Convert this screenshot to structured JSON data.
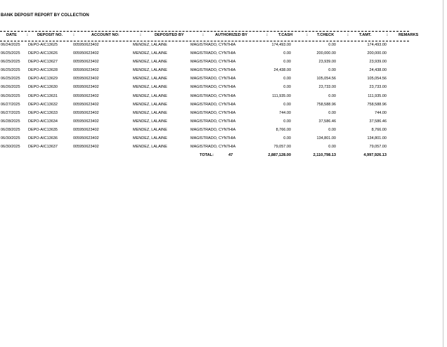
{
  "report": {
    "title": "BANK DEPOSIT REPORT BY COLLECTION"
  },
  "columns": {
    "date": "DATE",
    "sep1": ":",
    "deposit_no": "DEPOSIT NO.",
    "sep2": ":",
    "account_no": "ACCOUNT NO:",
    "sep3": ":",
    "deposited_by": "DEPOSITED BY",
    "sep4": ":",
    "authorized_by": "AUTHORIZED BY",
    "sep5": ":",
    "t_cash": "T.CASH",
    "sep6": ":",
    "t_check": "T.CHECK",
    "sep7": ":",
    "t_amt": "T.AMT.",
    "sep8": ":",
    "remarks": "REMARKS"
  },
  "rows": [
    {
      "date": "06/24/2025",
      "deposit_no": "DEPO-AIC13625",
      "account_no": "005950623402",
      "deposited_by": "MENDEZ, LALAINE",
      "authorized_by": "MAGISTRADO, CYNTHIA",
      "t_cash": "174,493.00",
      "t_check": "0.00",
      "t_amt": "174,493.00"
    },
    {
      "date": "06/25/2025",
      "deposit_no": "DEPO-AIC13626",
      "account_no": "005950623402",
      "deposited_by": "MENDEZ, LALAINE",
      "authorized_by": "MAGISTRADO, CYNTHIA",
      "t_cash": "0.00",
      "t_check": "200,000.00",
      "t_amt": "200,000.00"
    },
    {
      "date": "06/25/2025",
      "deposit_no": "DEPO-AIC13627",
      "account_no": "005950623402",
      "deposited_by": "MENDEZ, LALAINE",
      "authorized_by": "MAGISTRADO, CYNTHIA",
      "t_cash": "0.00",
      "t_check": "23,939.00",
      "t_amt": "23,939.00"
    },
    {
      "date": "06/25/2025",
      "deposit_no": "DEPO-AIC13628",
      "account_no": "005950623402",
      "deposited_by": "MENDEZ, LALAINE",
      "authorized_by": "MAGISTRADO, CYNTHIA",
      "t_cash": "24,438.00",
      "t_check": "0.00",
      "t_amt": "24,438.00"
    },
    {
      "date": "06/25/2025",
      "deposit_no": "DEPO-AIC13629",
      "account_no": "005950623402",
      "deposited_by": "MENDEZ, LALAINE",
      "authorized_by": "MAGISTRADO, CYNTHIA",
      "t_cash": "0.00",
      "t_check": "105,054.56",
      "t_amt": "105,054.56"
    },
    {
      "date": "06/26/2025",
      "deposit_no": "DEPO-AIC13630",
      "account_no": "005950623402",
      "deposited_by": "MENDEZ, LALAINE",
      "authorized_by": "MAGISTRADO, CYNTHIA",
      "t_cash": "0.00",
      "t_check": "23,733.00",
      "t_amt": "23,733.00"
    },
    {
      "date": "06/26/2025",
      "deposit_no": "DEPO-AIC13631",
      "account_no": "005950623402",
      "deposited_by": "MENDEZ, LALAINE",
      "authorized_by": "MAGISTRADO, CYNTHIA",
      "t_cash": "111,935.00",
      "t_check": "0.00",
      "t_amt": "111,935.00"
    },
    {
      "date": "06/27/2025",
      "deposit_no": "DEPO-AIC13632",
      "account_no": "005950623402",
      "deposited_by": "MENDEZ, LALAINE",
      "authorized_by": "MAGISTRADO, CYNTHIA",
      "t_cash": "0.00",
      "t_check": "758,588.96",
      "t_amt": "758,588.96"
    },
    {
      "date": "06/27/2025",
      "deposit_no": "DEPO-AIC13633",
      "account_no": "005950623402",
      "deposited_by": "MENDEZ, LALAINE",
      "authorized_by": "MAGISTRADO, CYNTHIA",
      "t_cash": "744.00",
      "t_check": "0.00",
      "t_amt": "744.00"
    },
    {
      "date": "06/28/2025",
      "deposit_no": "DEPO-AIC13634",
      "account_no": "005950623402",
      "deposited_by": "MENDEZ, LALAINE",
      "authorized_by": "MAGISTRADO, CYNTHIA",
      "t_cash": "0.00",
      "t_check": "37,586.46",
      "t_amt": "37,586.46"
    },
    {
      "date": "06/28/2025",
      "deposit_no": "DEPO-AIC13635",
      "account_no": "005950623402",
      "deposited_by": "MENDEZ, LALAINE",
      "authorized_by": "MAGISTRADO, CYNTHIA",
      "t_cash": "8,766.00",
      "t_check": "0.00",
      "t_amt": "8,766.00"
    },
    {
      "date": "06/30/2025",
      "deposit_no": "DEPO-AIC13636",
      "account_no": "005950623402",
      "deposited_by": "MENDEZ, LALAINE",
      "authorized_by": "MAGISTRADO, CYNTHIA",
      "t_cash": "0.00",
      "t_check": "134,801.00",
      "t_amt": "134,801.00"
    },
    {
      "date": "06/30/2025",
      "deposit_no": "DEPO-AIC13637",
      "account_no": "005950623402",
      "deposited_by": "MENDEZ, LALAINE",
      "authorized_by": "MAGISTRADO, CYNTHIA",
      "t_cash": "79,057.00",
      "t_check": "0.00",
      "t_amt": "79,057.00"
    }
  ],
  "total": {
    "label": "TOTAL:",
    "count": "47",
    "t_cash": "2,887,128.00",
    "t_check": "2,110,798.13",
    "t_amt": "4,997,926.13"
  }
}
